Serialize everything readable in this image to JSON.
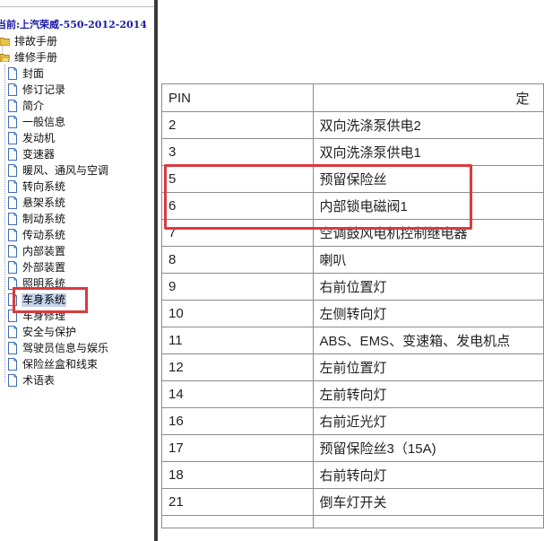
{
  "tree": {
    "title": "当前:上汽荣威-550-2012-2014",
    "folders": [
      {
        "label": "排故手册"
      },
      {
        "label": "维修手册"
      }
    ],
    "items": [
      {
        "label": "封面"
      },
      {
        "label": "修订记录"
      },
      {
        "label": "简介"
      },
      {
        "label": "一般信息"
      },
      {
        "label": "发动机"
      },
      {
        "label": "变速器"
      },
      {
        "label": "暖风、通风与空调"
      },
      {
        "label": "转向系统"
      },
      {
        "label": "悬架系统"
      },
      {
        "label": "制动系统"
      },
      {
        "label": "传动系统"
      },
      {
        "label": "内部装置"
      },
      {
        "label": "外部装置"
      },
      {
        "label": "照明系统"
      },
      {
        "label": "车身系统",
        "selected": true
      },
      {
        "label": "车身修理"
      },
      {
        "label": "安全与保护"
      },
      {
        "label": "驾驶员信息与娱乐"
      },
      {
        "label": "保险丝盒和线束"
      },
      {
        "label": "术语表"
      }
    ]
  },
  "table": {
    "headers": {
      "pin": "PIN",
      "definition": "定"
    },
    "rows": [
      {
        "pin": "2",
        "definition": "双向洗涤泵供电2"
      },
      {
        "pin": "3",
        "definition": "双向洗涤泵供电1"
      },
      {
        "pin": "5",
        "definition": "预留保险丝"
      },
      {
        "pin": "6",
        "definition": "内部锁电磁阀1"
      },
      {
        "pin": "7",
        "definition": "空调鼓风电机控制继电器"
      },
      {
        "pin": "8",
        "definition": "喇叭"
      },
      {
        "pin": "9",
        "definition": "右前位置灯"
      },
      {
        "pin": "10",
        "definition": "左侧转向灯"
      },
      {
        "pin": "11",
        "definition": "ABS、EMS、变速箱、发电机点"
      },
      {
        "pin": "12",
        "definition": "左前位置灯"
      },
      {
        "pin": "14",
        "definition": "左前转向灯"
      },
      {
        "pin": "16",
        "definition": "右前近光灯"
      },
      {
        "pin": "17",
        "definition": "预留保险丝3（15A)"
      },
      {
        "pin": "18",
        "definition": "右前转向灯"
      },
      {
        "pin": "21",
        "definition": "倒车灯开关"
      }
    ]
  },
  "colors": {
    "highlight": "#d93a3e",
    "selection": "#c4d4ec",
    "title_text": "#1a1aa6",
    "splitter": "#3a3a3a"
  }
}
